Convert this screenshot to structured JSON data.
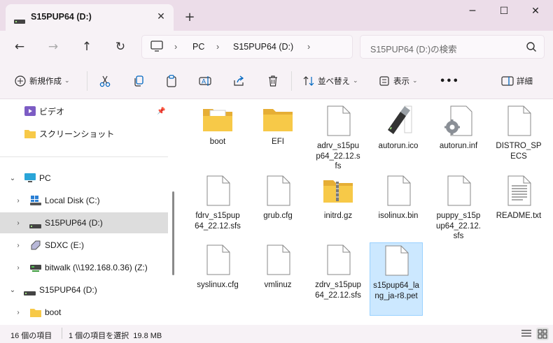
{
  "window": {
    "tab_title": "S15PUP64 (D:)",
    "new_tab": "+",
    "minimize": "─",
    "maximize": "☐",
    "close": "✕",
    "tab_close": "✕"
  },
  "nav": {
    "back": "←",
    "forward": "→",
    "up": "↑",
    "refresh": "↻"
  },
  "address": {
    "crumbs": [
      "PC",
      "S15PUP64 (D:)"
    ]
  },
  "search": {
    "placeholder": "S15PUP64 (D:)の検索"
  },
  "toolbar": {
    "new": "新規作成",
    "sort": "並べ替え",
    "view": "表示",
    "more": "•••",
    "details": "詳細"
  },
  "sidebar": {
    "items": [
      {
        "label": "ビデオ",
        "icon": "video-folder-icon",
        "pinned": true
      },
      {
        "label": "スクリーンショット",
        "icon": "folder-icon"
      },
      {
        "label": "PC",
        "icon": "pc-icon",
        "expanded": true
      },
      {
        "label": "Local Disk (C:)",
        "icon": "windows-drive-icon"
      },
      {
        "label": "S15PUP64 (D:)",
        "icon": "drive-icon",
        "selected": true
      },
      {
        "label": "SDXC (E:)",
        "icon": "sd-card-icon"
      },
      {
        "label": "bitwalk (\\\\192.168.0.36) (Z:)",
        "icon": "network-drive-icon"
      },
      {
        "label": "S15PUP64 (D:)",
        "icon": "drive-icon",
        "expanded": true
      },
      {
        "label": "boot",
        "icon": "folder-icon"
      }
    ]
  },
  "files": [
    {
      "name": "boot",
      "icon": "folder-doc-icon"
    },
    {
      "name": "EFI",
      "icon": "folder-icon"
    },
    {
      "name": "adrv_s15pup64_22.12.sfs",
      "icon": "file-icon"
    },
    {
      "name": "autorun.ico",
      "icon": "usb-drive-image-icon"
    },
    {
      "name": "autorun.inf",
      "icon": "settings-file-icon"
    },
    {
      "name": "DISTRO_SPECS",
      "icon": "file-icon"
    },
    {
      "name": "fdrv_s15pup64_22.12.sfs",
      "icon": "file-icon"
    },
    {
      "name": "grub.cfg",
      "icon": "file-icon"
    },
    {
      "name": "initrd.gz",
      "icon": "zip-folder-icon"
    },
    {
      "name": "isolinux.bin",
      "icon": "file-icon"
    },
    {
      "name": "puppy_s15pup64_22.12.sfs",
      "icon": "file-icon"
    },
    {
      "name": "README.txt",
      "icon": "text-file-icon"
    },
    {
      "name": "syslinux.cfg",
      "icon": "file-icon"
    },
    {
      "name": "vmlinuz",
      "icon": "file-icon"
    },
    {
      "name": "zdrv_s15pup64_22.12.sfs",
      "icon": "file-icon"
    },
    {
      "name": "s15pup64_lang_ja-r8.pet",
      "icon": "file-icon",
      "selected": true
    }
  ],
  "status": {
    "count": "16 個の項目",
    "selection": "1 個の項目を選択  19.8 MB"
  },
  "colors": {
    "accent": "#0067c0",
    "selection": "#cce8ff",
    "folder": "#f7c948"
  }
}
